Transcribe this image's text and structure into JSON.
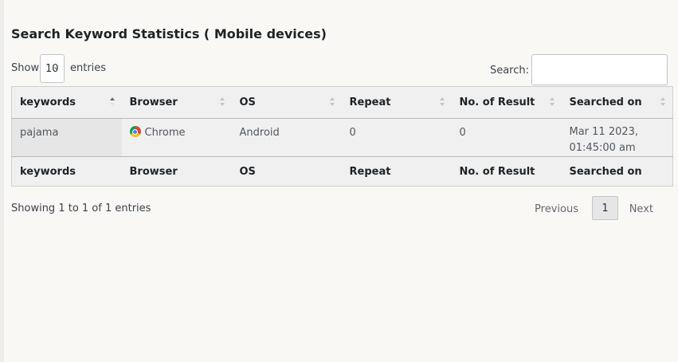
{
  "title": "Search Keyword Statistics ( Mobile devices)",
  "length": {
    "show_label": "Show",
    "selected": "10",
    "entries_label": "entries"
  },
  "search": {
    "label": "Search:",
    "value": ""
  },
  "table": {
    "columns": [
      "keywords",
      "Browser",
      "OS",
      "Repeat",
      "No. of Result",
      "Searched on"
    ],
    "sorted_column": "keywords",
    "rows": [
      {
        "keyword": "pajama",
        "browser": "Chrome",
        "browser_icon": "chrome-icon",
        "os": "Android",
        "repeat": "0",
        "results": "0",
        "searched_on_date": "Mar 11 2023,",
        "searched_on_time": "01:45:00 am"
      }
    ],
    "footer": [
      "keywords",
      "Browser",
      "OS",
      "Repeat",
      "No. of Result",
      "Searched on"
    ]
  },
  "info": "Showing 1 to 1 of 1 entries",
  "pagination": {
    "previous": "Previous",
    "current": "1",
    "next": "Next"
  }
}
